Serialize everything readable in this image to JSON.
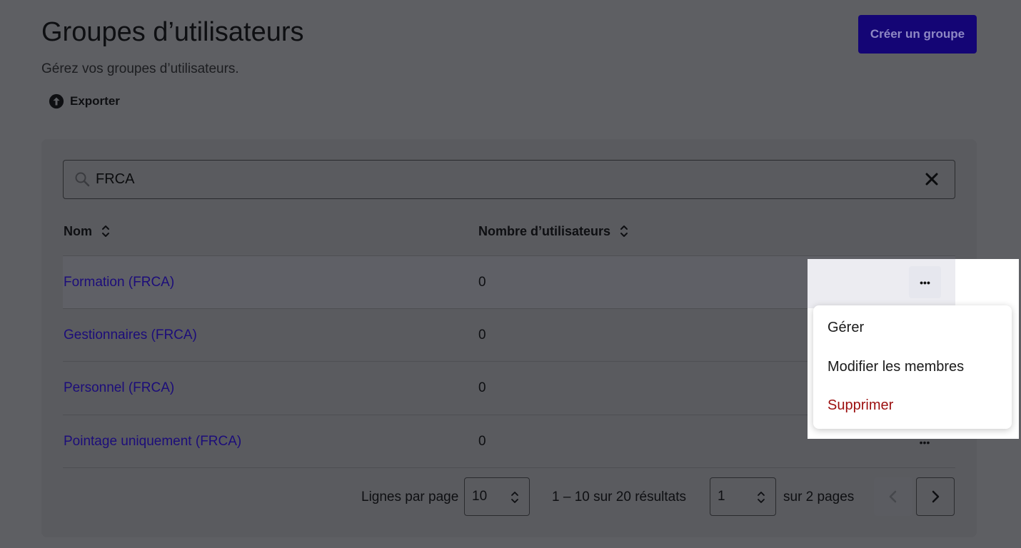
{
  "header": {
    "title": "Groupes d’utilisateurs",
    "subtitle": "Gérez vos groupes d’utilisateurs.",
    "create_button": "Créer un groupe",
    "export_label": "Exporter"
  },
  "search": {
    "value": "FRCA"
  },
  "table": {
    "columns": [
      "Nom",
      "Nombre d’utilisateurs"
    ],
    "rows": [
      {
        "name": "Formation (FRCA)",
        "count": "0"
      },
      {
        "name": "Gestionnaires (FRCA)",
        "count": "0"
      },
      {
        "name": "Personnel (FRCA)",
        "count": "0"
      },
      {
        "name": "Pointage uniquement (FRCA)",
        "count": "0"
      }
    ],
    "more_glyph": "•••"
  },
  "pagination": {
    "rows_per_page_label": "Lignes par page",
    "rows_per_page_value": "10",
    "range_text": "1 – 10 sur 20 résultats",
    "page_value": "1",
    "pages_text": "sur 2 pages"
  },
  "context_menu": {
    "items": [
      {
        "label": "Gérer"
      },
      {
        "label": "Modifier les membres"
      },
      {
        "label": "Supprimer"
      }
    ]
  },
  "icons": {
    "export": "upload-arrow-icon",
    "search": "search-icon",
    "clear": "close-icon",
    "sort": "sort-icon",
    "prev": "chevron-left-icon",
    "next": "chevron-right-icon"
  },
  "colors": {
    "primary": "#140575",
    "link": "#1c0d7a",
    "danger": "#9c0f0f"
  }
}
